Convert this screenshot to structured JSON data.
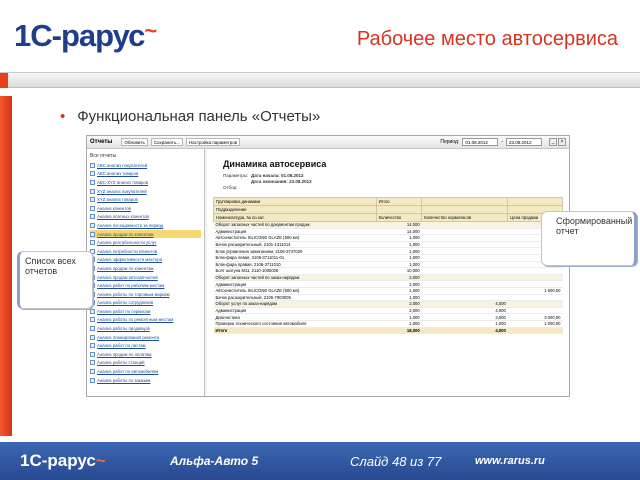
{
  "brand": {
    "logo_text": "1С-рарус",
    "accent": "#e8401c",
    "blue": "#1f3d8a"
  },
  "slide": {
    "title": "Рабочее место автосервиса",
    "bullet": "Функциональная панель «Отчеты»"
  },
  "window": {
    "title": "Отчеты",
    "toolbar": {
      "refresh": "Обновить",
      "save": "Сохранить...",
      "settings": "Настройка параметров",
      "period_label": "Период:",
      "date_from": "01.08.2012",
      "date_to": "23.08.2012"
    },
    "left_panel": {
      "header": "Все отчеты",
      "items": [
        "ABC анализ покупателей",
        "ABC анализ товаров",
        "ABC-XYZ анализ товаров",
        "XYZ анализ покупателей",
        "XYZ анализ товаров",
        "Анализ клиентов",
        "Анализ платных клиентов",
        "Анализ посещаемости за период",
        "Анализ продаж по клиентам",
        "Анализ рентабельности услуг",
        "Анализ потребности клиентов",
        "Анализ эффективности мастера",
        "Анализ продаж по клиентам",
        "Анализ продаж автозапчастей",
        "Анализ работ по рабочим местам",
        "Анализ работы по торговым маркам",
        "Анализ работы сотрудников",
        "Анализ работ по сервисам",
        "Анализ работы по ремонтным местам",
        "Анализ работы продавцов",
        "Анализ планирования ремонта",
        "Анализ работ по листам",
        "Анализ продаж по оплатам",
        "Анализ работы станций",
        "Анализ работ по автомобилям",
        "Анализ работы по заказам"
      ],
      "selected_index": 8
    },
    "report": {
      "title": "Динамика автосервиса",
      "params_label": "Параметры:",
      "date_start_label": "Дата начала:",
      "date_start": "01.08.2012",
      "date_end_label": "Дата окончания:",
      "date_end": "23.08.2012",
      "filter_label": "Отбор:",
      "headers": [
        "Группировка динамики",
        "Подразделение",
        "Номенклатура, № по кат.",
        "Количество",
        "Количество нормочасов",
        "Цена продажи"
      ],
      "total_label": "Итого",
      "rows": [
        [
          "Оборот запасных частей по документам продаж",
          "14,000",
          "",
          "",
          "g"
        ],
        [
          "Администрация",
          "14,000",
          "",
          "",
          ""
        ],
        [
          "Автоочиститель SILICONE GLAZE (500 мл)",
          "1,000",
          "",
          "1 600,00",
          ""
        ],
        [
          "Бачок расширительный, 2101-1311014",
          "1,000",
          "",
          "",
          ""
        ],
        [
          "Блок управления зажиганием, 2106-3747020",
          "1,000",
          "",
          "",
          ""
        ],
        [
          "Блок-фара левая, 2106-3711011-01",
          "1,000",
          "",
          "",
          ""
        ],
        [
          "Блок-фара правая, 2106-3711010",
          "1,000",
          "",
          "",
          ""
        ],
        [
          "Болт шатуна М11, 2110-1005028",
          "10,000",
          "",
          "",
          ""
        ],
        [
          "Оборот запасных частей по заказ-нарядам",
          "2,000",
          "",
          "",
          "g"
        ],
        [
          "Администрация",
          "2,000",
          "",
          "",
          ""
        ],
        [
          "Автоочиститель SILICONE GLAZE (500 мл)",
          "1,000",
          "",
          "1 600,00",
          ""
        ],
        [
          "Бачок расширительный, 2106-7903005",
          "1,000",
          "",
          "",
          ""
        ],
        [
          "Оборот услуг по заказ-нарядам",
          "2,000",
          "4,000",
          "",
          "g"
        ],
        [
          "Администрация",
          "2,000",
          "4,000",
          "",
          ""
        ],
        [
          "Диагностика",
          "1,000",
          "3,000",
          "3 000,00",
          ""
        ],
        [
          "Проверка технического состояния автомобиля",
          "1,000",
          "1,000",
          "1 000,00",
          ""
        ]
      ],
      "total": [
        "Итого",
        "18,000",
        "4,000",
        ""
      ]
    }
  },
  "callouts": {
    "left": "Список всех отчетов",
    "right": "Сформированный отчет"
  },
  "footer": {
    "logo": "1С-рарус",
    "product": "Альфа-Авто 5",
    "slide_number": "Слайд 48 из 77",
    "url": "www.rarus.ru"
  }
}
